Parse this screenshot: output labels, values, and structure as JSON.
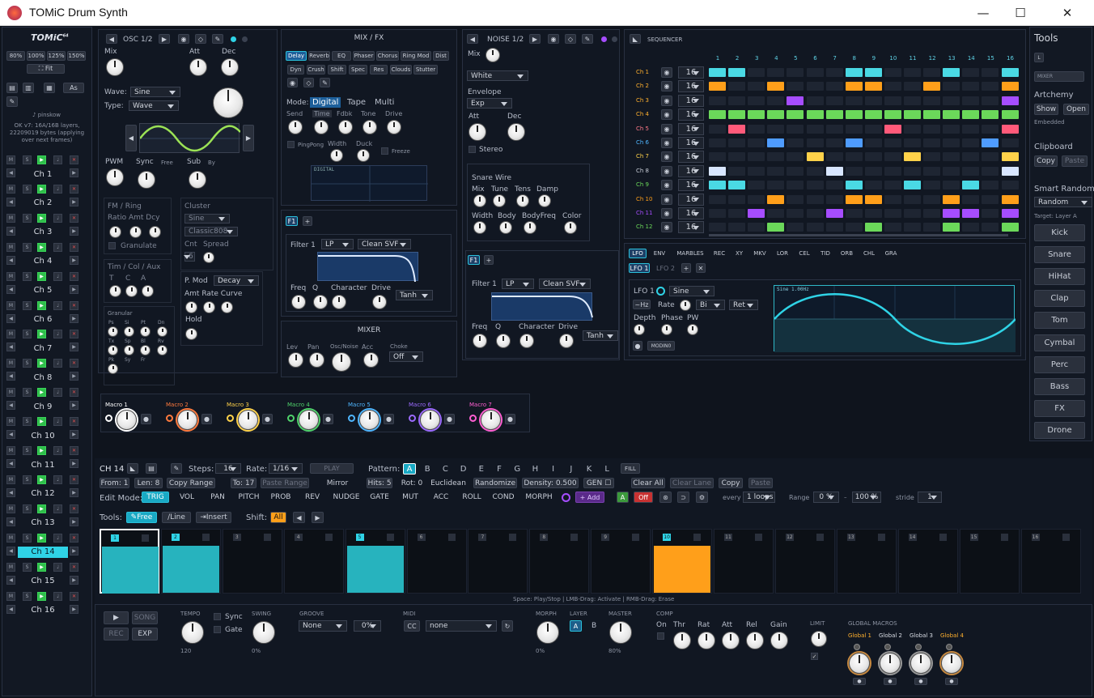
{
  "app": {
    "title": "TOMiC Drum Synth",
    "logo": "TOMiC",
    "logo_sup": "64"
  },
  "left": {
    "zoom": [
      "80%",
      "100%",
      "125%",
      "150%"
    ],
    "fit": "⛶ Fit",
    "as": "As",
    "user": "♪ pinskow",
    "status": "OK v7: 16A/16B layers, 22209019 bytes (applying over next frames)",
    "channels": [
      "Ch 1",
      "Ch 2",
      "Ch 3",
      "Ch 4",
      "Ch 5",
      "Ch 6",
      "Ch 7",
      "Ch 8",
      "Ch 9",
      "Ch 10",
      "Ch 11",
      "Ch 12",
      "Ch 13",
      "Ch 14",
      "Ch 15",
      "Ch 16"
    ],
    "m": "M",
    "s": "S",
    "x": "✕"
  },
  "osc": {
    "title": "OSC 1/2",
    "mix": "Mix",
    "att": "Att",
    "dec": "Dec",
    "wave_label": "Wave:",
    "wave": "Sine",
    "type_label": "Type:",
    "type": "Wave",
    "pwm": "PWM",
    "sync": "Sync",
    "free": "Free",
    "sub": "Sub",
    "by": "By",
    "fm_title": "FM / Ring",
    "fm_labels": "Ratio Amt Dcy",
    "granulate": "Granulate",
    "cluster": "Cluster",
    "cluster_wave": "Sine",
    "cluster_model": "Classic808",
    "cnt": "Cnt",
    "spread": "Spread",
    "cnt_val": "6",
    "tca": "Tim / Col / Aux",
    "t": "T",
    "c": "C",
    "a": "A",
    "pmod": "P. Mod",
    "pmod_val": "Decay",
    "amt_rate_curve": "Amt Rate Curve",
    "hold": "Hold",
    "granular": "Granular",
    "gran_labels": [
      "Ps",
      "Si",
      "Pt",
      "Dn",
      "Tx",
      "Sp",
      "Bl",
      "Rv",
      "Pk",
      "Sy",
      "Fr"
    ]
  },
  "mixfx": {
    "title": "MIX / FX",
    "tabs1": [
      "Delay",
      "Reverb",
      "EQ",
      "Phaser",
      "Chorus",
      "Ring Mod",
      "Dist"
    ],
    "tabs2": [
      "Dyn",
      "Crush",
      "Shift",
      "Spec",
      "Res",
      "Clouds",
      "Stutter"
    ],
    "mode": "Mode:",
    "modes": [
      "Digital",
      "Tape",
      "Multi"
    ],
    "knobs": [
      "Send",
      "Time",
      "Fdbk",
      "Tone",
      "Drive"
    ],
    "pingpong": "PingPong",
    "width": "Width",
    "duck": "Duck",
    "freeze": "Freeze",
    "display": "DIGITAL",
    "f1": "F1",
    "filter": "Filter 1",
    "lp": "LP",
    "svf": "Clean SVF",
    "fk": [
      "Freq",
      "Q",
      "Character",
      "Drive"
    ],
    "tanh": "Tanh",
    "mixer": "MIXER",
    "mixer_knobs": [
      "Lev",
      "Pan",
      "Osc/Noise",
      "Acc"
    ],
    "choke": "Choke",
    "choke_val": "Off"
  },
  "noise": {
    "title": "NOISE 1/2",
    "mix": "Mix",
    "color": "White",
    "env": "Envelope",
    "env_val": "Exp",
    "att": "Att",
    "dec": "Dec",
    "stereo": "Stereo",
    "snare": "Snare Wire",
    "sk1": [
      "Mix",
      "Tune",
      "Tens",
      "Damp"
    ],
    "sk2": [
      "Width",
      "Body",
      "BodyFreq",
      "Color"
    ],
    "f1": "F1",
    "filter": "Filter 1",
    "lp": "LP",
    "svf": "Clean SVF",
    "fk": [
      "Freq",
      "Q",
      "Character",
      "Drive"
    ],
    "tanh": "Tanh"
  },
  "macros": [
    {
      "label": "Macro 1",
      "color": "#ffffff"
    },
    {
      "label": "Macro 2",
      "color": "#ff7a3d"
    },
    {
      "label": "Macro 3",
      "color": "#ffd24a"
    },
    {
      "label": "Macro 4",
      "color": "#4fd36b"
    },
    {
      "label": "Macro 5",
      "color": "#4fb6ff"
    },
    {
      "label": "Macro 6",
      "color": "#9c6bff"
    },
    {
      "label": "Macro 7",
      "color": "#ff5fd2"
    }
  ],
  "seq": {
    "title": "SEQUENCER",
    "steps": [
      "1",
      "2",
      "3",
      "4",
      "5",
      "6",
      "7",
      "8",
      "9",
      "10",
      "11",
      "12",
      "13",
      "14",
      "15",
      "16"
    ],
    "rows": [
      {
        "name": "Ch 1",
        "color": "#ffb02e",
        "len": "16",
        "steps": [
          1,
          1,
          0,
          0,
          0,
          0,
          0,
          1,
          1,
          0,
          0,
          0,
          1,
          0,
          0,
          1
        ],
        "c": "#4ad9e4"
      },
      {
        "name": "Ch 2",
        "color": "#ffb02e",
        "len": "16",
        "steps": [
          1,
          0,
          0,
          1,
          0,
          0,
          0,
          1,
          1,
          0,
          0,
          1,
          0,
          0,
          0,
          1
        ],
        "c": "#ff9f1a"
      },
      {
        "name": "Ch 3",
        "color": "#ffb02e",
        "len": "16",
        "steps": [
          0,
          0,
          0,
          0,
          1,
          0,
          0,
          0,
          0,
          0,
          0,
          0,
          0,
          0,
          0,
          1
        ],
        "c": "#a64dff"
      },
      {
        "name": "Ch 4",
        "color": "#ffb02e",
        "len": "16",
        "steps": [
          1,
          1,
          1,
          1,
          1,
          1,
          1,
          1,
          1,
          1,
          1,
          1,
          1,
          1,
          1,
          1
        ],
        "c": "#6bd85a"
      },
      {
        "name": "Ch 5",
        "color": "#ff7a8a",
        "len": "16",
        "steps": [
          0,
          1,
          0,
          0,
          0,
          0,
          0,
          0,
          0,
          1,
          0,
          0,
          0,
          0,
          0,
          1
        ],
        "c": "#ff5a7a"
      },
      {
        "name": "Ch 6",
        "color": "#4fb6ff",
        "len": "16",
        "steps": [
          0,
          0,
          0,
          1,
          0,
          0,
          0,
          1,
          0,
          0,
          0,
          0,
          0,
          0,
          1,
          0
        ],
        "c": "#4f9cff"
      },
      {
        "name": "Ch 7",
        "color": "#ffd24a",
        "len": "16",
        "steps": [
          0,
          0,
          0,
          0,
          0,
          1,
          0,
          0,
          0,
          0,
          1,
          0,
          0,
          0,
          0,
          1
        ],
        "c": "#ffd24a"
      },
      {
        "name": "Ch 8",
        "color": "#c9ced8",
        "len": "16",
        "steps": [
          1,
          0,
          0,
          0,
          0,
          0,
          1,
          0,
          0,
          0,
          0,
          0,
          0,
          0,
          0,
          1
        ],
        "c": "#d8e6ff"
      },
      {
        "name": "Ch 9",
        "color": "#6bd85a",
        "len": "16",
        "steps": [
          1,
          1,
          0,
          0,
          0,
          0,
          0,
          1,
          0,
          0,
          1,
          0,
          0,
          1,
          0,
          0
        ],
        "c": "#4ad9e4"
      },
      {
        "name": "Ch 10",
        "color": "#ff9f1a",
        "len": "16",
        "steps": [
          0,
          0,
          0,
          1,
          0,
          0,
          0,
          1,
          1,
          0,
          0,
          0,
          1,
          0,
          0,
          1
        ],
        "c": "#ff9f1a"
      },
      {
        "name": "Ch 11",
        "color": "#a64dff",
        "len": "16",
        "steps": [
          0,
          0,
          1,
          0,
          0,
          0,
          1,
          0,
          0,
          0,
          0,
          0,
          1,
          1,
          0,
          1
        ],
        "c": "#a64dff"
      },
      {
        "name": "Ch 12",
        "color": "#6bd85a",
        "len": "16",
        "steps": [
          0,
          0,
          0,
          1,
          0,
          0,
          0,
          0,
          1,
          0,
          0,
          0,
          1,
          0,
          0,
          1
        ],
        "c": "#6bd85a"
      }
    ]
  },
  "lfo": {
    "tabs": [
      "LFO",
      "ENV",
      "MARBLES",
      "REC",
      "XY",
      "MKV",
      "LOR",
      "CEL",
      "TID",
      "ORB",
      "CHL",
      "GRA"
    ],
    "sub": [
      "LFO 1",
      "LFO 2"
    ],
    "name": "LFO 1",
    "wave": "Sine",
    "hz": "~Hz",
    "rate": "Rate",
    "bi": "Bi",
    "ret": "Ret",
    "depth": "Depth",
    "phase": "Phase",
    "pw": "PW",
    "modinq": "MODIN0",
    "display": "Sine 1.00Hz"
  },
  "tools": {
    "title": "Tools",
    "l": "L",
    "mixer": "MIXER",
    "artchemy": "Artchemy",
    "show": "Show",
    "open": "Open",
    "embedded": "Embedded",
    "clipboard": "Clipboard",
    "copy": "Copy",
    "paste": "Paste",
    "smart": "Smart Random",
    "random": "Random",
    "target": "Target: Layer A",
    "buttons": [
      "Kick",
      "Snare",
      "HiHat",
      "Clap",
      "Tom",
      "Cymbal",
      "Perc",
      "Bass",
      "FX",
      "Drone"
    ]
  },
  "edit": {
    "ch": "CH 14",
    "steps_label": "Steps:",
    "steps": "16",
    "rate_label": "Rate:",
    "rate": "1/16",
    "play": "PLAY",
    "pattern_label": "Pattern:",
    "patterns": [
      "A",
      "B",
      "C",
      "D",
      "E",
      "F",
      "G",
      "H",
      "I",
      "J",
      "K",
      "L"
    ],
    "fill": "FILL",
    "row2": [
      "From: 1",
      "Len: 8",
      "Copy Range",
      "To: 17",
      "Paste Range",
      "Mirror",
      "Hits: 5",
      "Rot: 0",
      "Euclidean",
      "Randomize",
      "Density: 0.500",
      "GEN ☐",
      "Clear All",
      "Clear Lane",
      "Copy",
      "Paste"
    ],
    "mode_label": "Edit Mode:",
    "modes": [
      "TRIG",
      "VOL",
      "PAN",
      "PITCH",
      "PROB",
      "REV",
      "NUDGE",
      "GATE",
      "MUT",
      "ACC",
      "ROLL",
      "COND",
      "MORPH"
    ],
    "add": "+ Add",
    "a": "A",
    "off": "Off",
    "every": "every",
    "loops": "1 loops",
    "range": "Range",
    "r0": "0 %",
    "r1": "100 %",
    "dash": "–",
    "stride": "stride",
    "stride_v": "1",
    "tools_label": "Tools:",
    "free": "Free",
    "line": "Line",
    "insert": "Insert",
    "shift": "Shift:",
    "all": "All",
    "pads": [
      1,
      1,
      0,
      0,
      1,
      0,
      0,
      0,
      0,
      2,
      0,
      0,
      0,
      0,
      0,
      0
    ],
    "pad_nums": [
      "1",
      "2",
      "3",
      "4",
      "5",
      "6",
      "7",
      "8",
      "9",
      "10",
      "11",
      "12",
      "13",
      "14",
      "15",
      "16"
    ],
    "hint": "Space: Play/Stop | LMB-Drag: Activate | RMB-Drag: Erase"
  },
  "transport": {
    "song": "SONG",
    "rec": "REC",
    "exp": "EXP",
    "tempo": "TEMPO",
    "tempo_v": "120",
    "sync": "Sync",
    "gate": "Gate",
    "swing": "SWING",
    "swing_v": "0%",
    "groove": "GROOVE",
    "groove_v": "None",
    "groove_pct": "0%",
    "midi": "MIDI",
    "cc": "CC",
    "midi_v": "none",
    "morph": "MORPH",
    "morph_v": "0%",
    "layer": "LAYER",
    "la": "A",
    "lb": "B",
    "master": "MASTER",
    "master_v": "80%",
    "comp": "COMP",
    "on": "On",
    "thr": "Thr",
    "rat": "Rat",
    "att": "Att",
    "rel": "Rel",
    "gain": "Gain",
    "limit": "LIMIT",
    "gm": "GLOBAL MACROS",
    "globals": [
      "Global 1",
      "Global 2",
      "Global 3",
      "Global 4"
    ]
  }
}
